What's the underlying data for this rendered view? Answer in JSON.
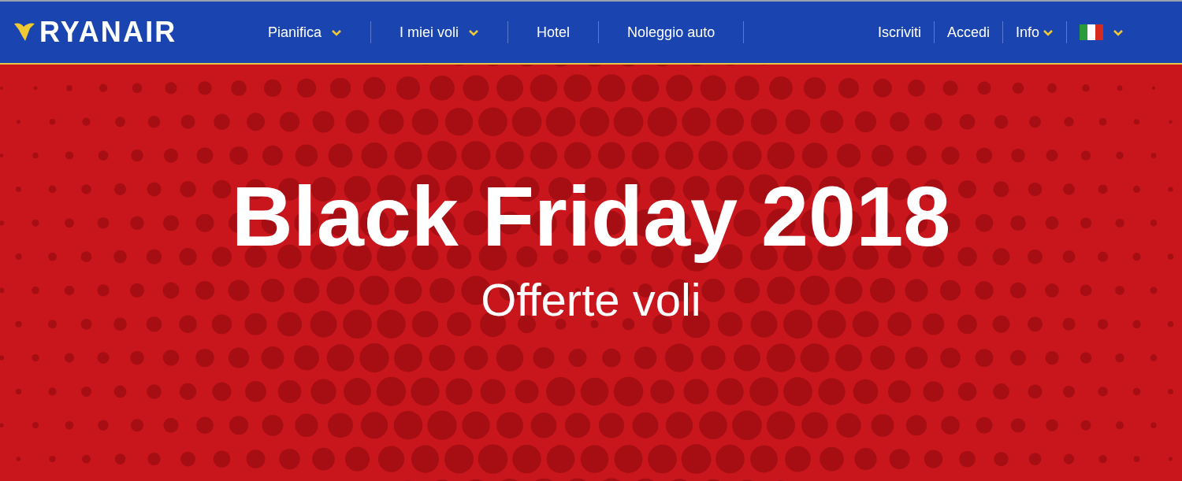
{
  "header": {
    "logo": "RYANAIR",
    "nav": [
      {
        "label": "Pianifica",
        "dropdown": true
      },
      {
        "label": "I miei voli",
        "dropdown": true
      },
      {
        "label": "Hotel",
        "dropdown": false
      },
      {
        "label": "Noleggio auto",
        "dropdown": false
      }
    ],
    "account": [
      {
        "label": "Iscriviti",
        "dropdown": false
      },
      {
        "label": "Accedi",
        "dropdown": false
      },
      {
        "label": "Info",
        "dropdown": true
      }
    ],
    "language": {
      "dropdown": true
    }
  },
  "hero": {
    "title": "Black Friday 2018",
    "subtitle": "Offerte voli"
  }
}
